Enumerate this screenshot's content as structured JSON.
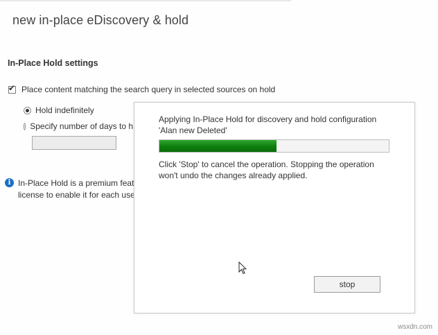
{
  "window": {
    "title": "new in-place eDiscovery & hold"
  },
  "hold_settings": {
    "heading": "In-Place Hold settings",
    "place_on_hold": {
      "label": "Place content matching the search query in selected sources on hold",
      "checked": true
    },
    "hold_indefinitely": {
      "label": "Hold indefinitely",
      "selected": true
    },
    "specify_days": {
      "label": "Specify number of days to h",
      "selected": false
    },
    "days_input_value": ""
  },
  "info": {
    "line1": "In-Place Hold is a premium featu",
    "line2": "license to enable it for each use"
  },
  "progress_dialog": {
    "message_line1": "Applying In-Place Hold for discovery and hold configuration",
    "message_line2": "'Alan new Deleted'",
    "progress_fraction": 0.51,
    "progress_color": "#0e7d0e",
    "note_line1": "Click 'Stop' to cancel the operation. Stopping the operation",
    "note_line2": "won't undo the changes already applied.",
    "stop_label": "stop"
  },
  "watermark": "wsxdn.com"
}
